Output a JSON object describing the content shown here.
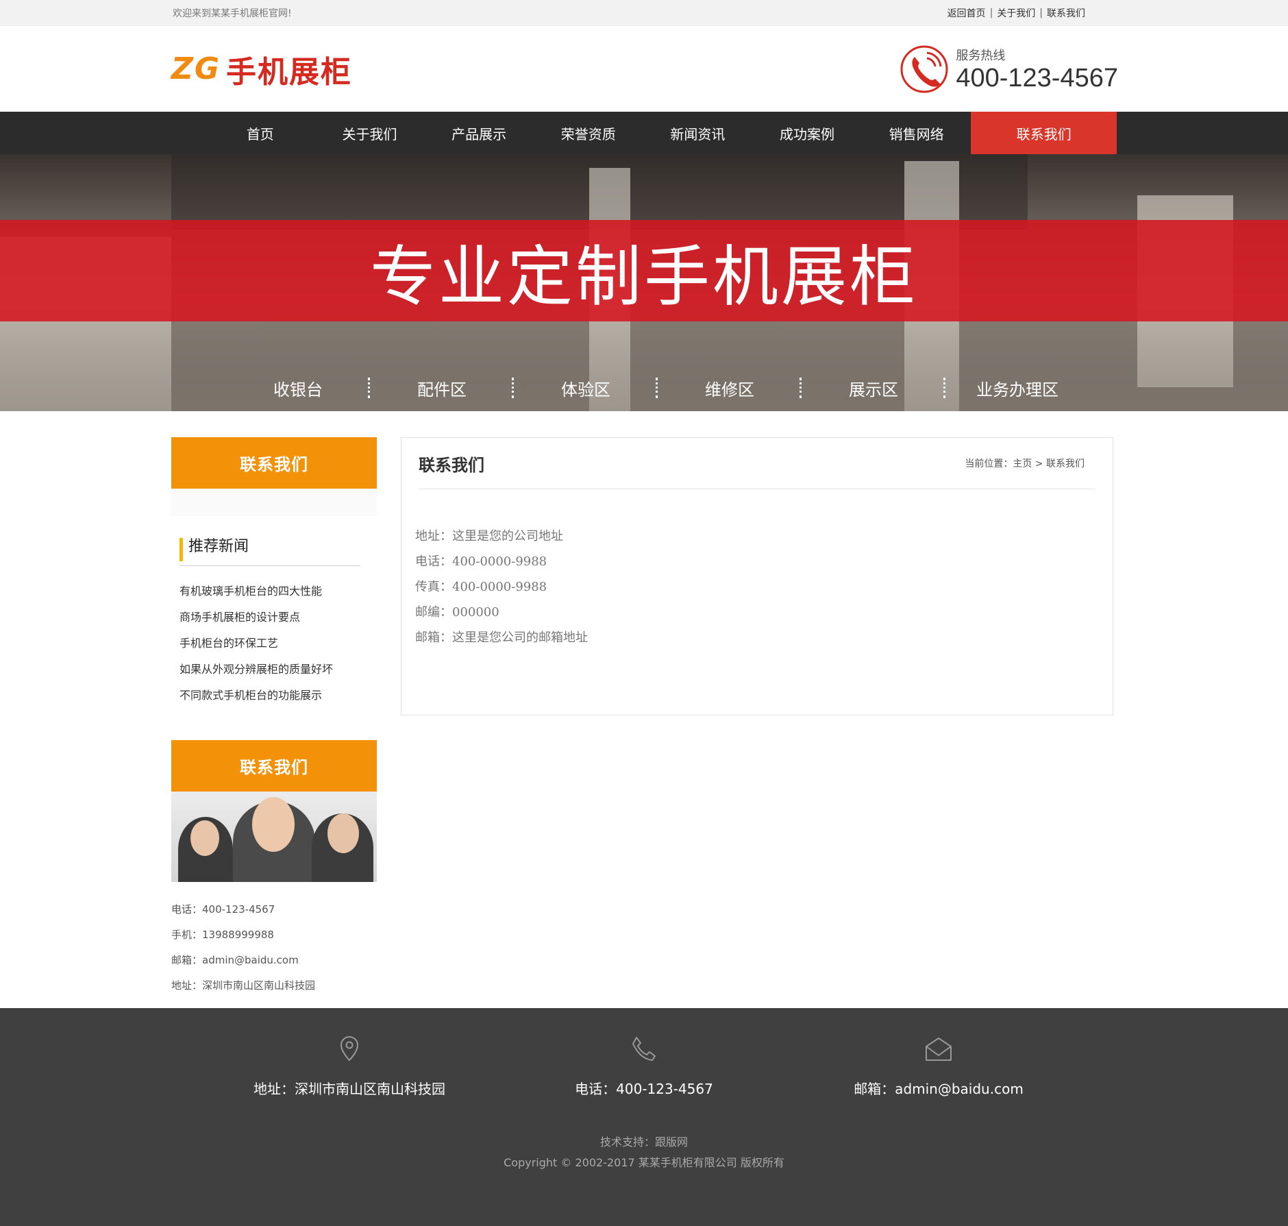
{
  "topbar": {
    "welcome": "欢迎来到某某手机展柜官网!",
    "links": [
      "返回首页",
      "关于我们",
      "联系我们"
    ]
  },
  "header": {
    "logo_latin": "ZG",
    "logo_cn": "手机展柜",
    "hotline_label": "服务热线",
    "hotline_number": "400-123-4567"
  },
  "nav": {
    "items": [
      "首页",
      "关于我们",
      "产品展示",
      "荣誉资质",
      "新闻资讯",
      "成功案例",
      "销售网络",
      "联系我们"
    ]
  },
  "banner": {
    "slogan": "专业定制手机展柜",
    "zones": [
      "收银台",
      "配件区",
      "体验区",
      "维修区",
      "展示区",
      "业务办理区"
    ]
  },
  "sidebar": {
    "head": "联系我们",
    "news_title": "推荐新闻",
    "news": [
      "有机玻璃手机柜台的四大性能",
      "商场手机展柜的设计要点",
      "手机柜台的环保工艺",
      "如果从外观分辨展柜的质量好坏",
      "不同款式手机柜台的功能展示"
    ],
    "contact_head": "联系我们",
    "contact": [
      "电话：400-123-4567",
      "手机：13988999988",
      "邮箱：admin@baidu.com",
      "地址：深圳市南山区南山科技园"
    ]
  },
  "content": {
    "title": "联系我们",
    "breadcrumb": "当前位置：主页 > 联系我们",
    "info": [
      "地址：这里是您的公司地址",
      "电话：400-0000-9988",
      "传真：400-0000-9988",
      "邮编：000000",
      "邮箱：这里是您公司的邮箱地址"
    ]
  },
  "footer": {
    "address": "地址：深圳市南山区南山科技园",
    "phone": "电话：400-123-4567",
    "email": "邮箱：admin@baidu.com",
    "support": "技术支持：跟版网",
    "copyright": "Copyright © 2002-2017 某某手机柜有限公司 版权所有"
  },
  "colors": {
    "nav_bg": "#2c2c2c",
    "nav_active": "#d9352a",
    "sidebar_head": "#f39208",
    "banner_band": "#d61620",
    "footer_bg": "#404040"
  },
  "icons": [
    "phone-icon",
    "location-icon",
    "phone-outline-icon",
    "mail-icon"
  ]
}
